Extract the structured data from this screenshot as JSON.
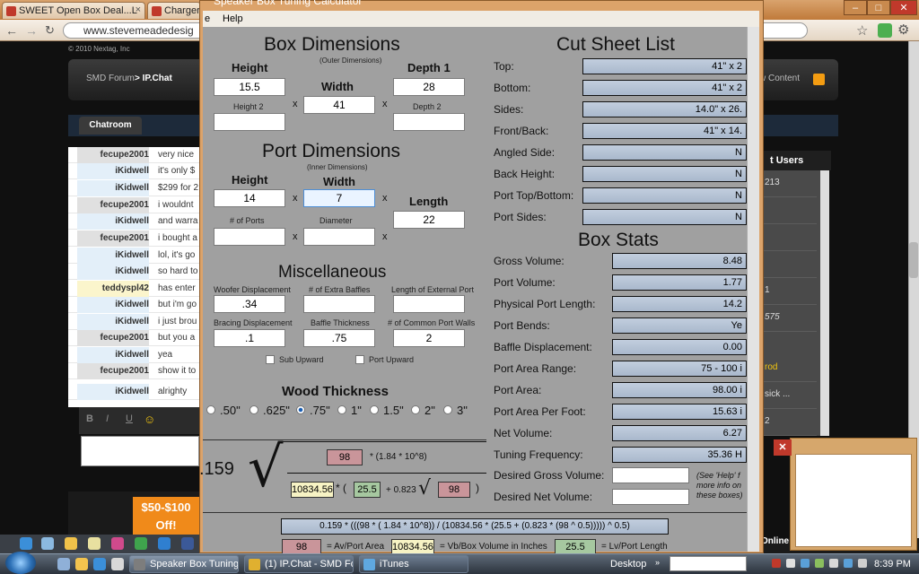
{
  "browser": {
    "tabs": [
      {
        "label": "SWEET Open Box Deal...L"
      },
      {
        "label": "Charger"
      }
    ],
    "url": "www.stevemeadedesig",
    "copyright": "© 2010 Nextag, Inc"
  },
  "site": {
    "nav_forum": "SMD Forum",
    "nav_chat": "> IP.Chat",
    "nav_content": "w Content",
    "chatroom_tab": "Chatroom",
    "users_head": "t Users",
    "online": "Online",
    "ad_offer": "$50-$100 Off!",
    "chat": [
      {
        "name": "fecupe2001",
        "msg": "very nice",
        "style": "grey"
      },
      {
        "name": "iKidwell",
        "msg": "it's only $",
        "style": "blue"
      },
      {
        "name": "iKidwell",
        "msg": "$299 for 2",
        "style": "blue"
      },
      {
        "name": "fecupe2001",
        "msg": "i wouldnt",
        "style": "grey"
      },
      {
        "name": "iKidwell",
        "msg": "and warra",
        "style": "blue"
      },
      {
        "name": "fecupe2001",
        "msg": "i bought a",
        "style": "grey"
      },
      {
        "name": "iKidwell",
        "msg": "lol, it's go",
        "style": "blue"
      },
      {
        "name": "iKidwell",
        "msg": "so hard to",
        "style": "blue"
      },
      {
        "name": "teddyspl42",
        "msg": "has enter",
        "style": "yel"
      },
      {
        "name": "iKidwell",
        "msg": "but i'm go",
        "style": "blue"
      },
      {
        "name": "iKidwell",
        "msg": "i just brou",
        "style": "blue"
      },
      {
        "name": "fecupe2001",
        "msg": "but you a",
        "style": "grey"
      },
      {
        "name": "iKidwell",
        "msg": "yea",
        "style": "blue"
      },
      {
        "name": "fecupe2001",
        "msg": "show it to",
        "style": "grey"
      },
      {
        "name": "iKidwell",
        "msg": "alrighty",
        "style": "blue"
      }
    ],
    "users": [
      "213",
      "",
      "",
      "",
      "1",
      "575",
      "rod",
      "sick ...",
      "",
      "2"
    ]
  },
  "app": {
    "title": "Speaker Box Tuning Calculator",
    "menu": {
      "edit": "e",
      "help": "Help"
    },
    "box": {
      "title": "Box Dimensions",
      "subtitle": "(Outer Dimensions)",
      "height_label": "Height",
      "height": "15.5",
      "width_label": "Width",
      "width": "41",
      "depth1_label": "Depth 1",
      "depth1": "28",
      "height2_label": "Height 2",
      "height2": "",
      "depth2_label": "Depth 2",
      "depth2": ""
    },
    "port": {
      "title": "Port Dimensions",
      "subtitle": "(Inner Dimensions)",
      "height_label": "Height",
      "height": "14",
      "width_label": "Width",
      "width": "7",
      "length_label": "Length",
      "length": "22",
      "ports_label": "# of Ports",
      "ports": "",
      "diameter_label": "Diameter",
      "diameter": ""
    },
    "misc": {
      "title": "Miscellaneous",
      "woofer_label": "Woofer Displacement",
      "woofer": ".34",
      "extra_baffles_label": "# of Extra Baffles",
      "extra_baffles": "",
      "ext_port_label": "Length of External Port",
      "ext_port": "",
      "bracing_label": "Bracing Displacement",
      "bracing": ".1",
      "baffle_thick_label": "Baffle Thickness",
      "baffle_thick": ".75",
      "common_walls_label": "# of Common Port Walls",
      "common_walls": "2",
      "sub_upward": "Sub Upward",
      "port_upward": "Port Upward"
    },
    "wood": {
      "title": "Wood Thickness",
      "options": [
        ".50\"",
        ".625\"",
        ".75\"",
        "1\"",
        "1.5\"",
        "2\"",
        "3\""
      ],
      "selected": ".75\""
    },
    "cutsheet": {
      "title": "Cut Sheet List",
      "rows": [
        {
          "label": "Top:",
          "value": "41\" x 2"
        },
        {
          "label": "Bottom:",
          "value": "41\" x 2"
        },
        {
          "label": "Sides:",
          "value": "14.0\" x 26."
        },
        {
          "label": "Front/Back:",
          "value": "41\" x 14."
        },
        {
          "label": "Angled Side:",
          "value": "N"
        },
        {
          "label": "Back Height:",
          "value": "N"
        },
        {
          "label": "Port Top/Bottom:",
          "value": "N"
        },
        {
          "label": "Port Sides:",
          "value": "N"
        }
      ]
    },
    "stats": {
      "title": "Box Stats",
      "rows": [
        {
          "label": "Gross Volume:",
          "value": "8.48"
        },
        {
          "label": "Port Volume:",
          "value": "1.77"
        },
        {
          "label": "Physical Port Length:",
          "value": "14.2"
        },
        {
          "label": "Port Bends:",
          "value": "Ye"
        },
        {
          "label": "Baffle Displacement:",
          "value": "0.00"
        },
        {
          "label": "Port Area Range:",
          "value": "75 - 100 i"
        },
        {
          "label": "Port Area:",
          "value": "98.00 i"
        },
        {
          "label": "Port Area Per Foot:",
          "value": "15.63 i"
        },
        {
          "label": "Net Volume:",
          "value": "6.27"
        },
        {
          "label": "Tuning Frequency:",
          "value": "35.36 H"
        }
      ],
      "desired_gross_label": "Desired Gross Volume:",
      "desired_net_label": "Desired Net Volume:",
      "note": "(See 'Help' f more info on these boxes)"
    },
    "formula": {
      "constant": ".159",
      "av": "98",
      "factor": "* (1.84 * 10^8)",
      "vb": "10834.56",
      "lv": "25.5",
      "plus": "+ 0.823",
      "av2": "98",
      "open_paren": "* (",
      "close_paren": ")",
      "full": "0.159 * (((98 * ( 1.84 * 10^8)) / (10834.56 * (25.5 + (0.823 * (98 ^ 0.5))))) ^ 0.5)",
      "legend_av_value": "98",
      "legend_av_text": "= Av/Port Area",
      "legend_vb_value": "10834.56",
      "legend_vb_text": "= Vb/Box Volume in Inches",
      "legend_lv_value": "25.5",
      "legend_lv_text": "= Lv/Port Length"
    }
  },
  "taskbar": {
    "buttons": [
      {
        "label": "Speaker Box Tuning ..."
      },
      {
        "label": "(1) IP.Chat - SMD Fo..."
      },
      {
        "label": "iTunes"
      }
    ],
    "desktop": "Desktop",
    "clock": "8:39 PM"
  },
  "colors": {
    "window_frame": "#dca36a",
    "client_bg": "#a0a0a0",
    "computed_box": "#b6c3d5",
    "av_pink": "#c9959a",
    "vb_yellow": "#f7f3c4",
    "lv_green": "#a6c8a0"
  }
}
